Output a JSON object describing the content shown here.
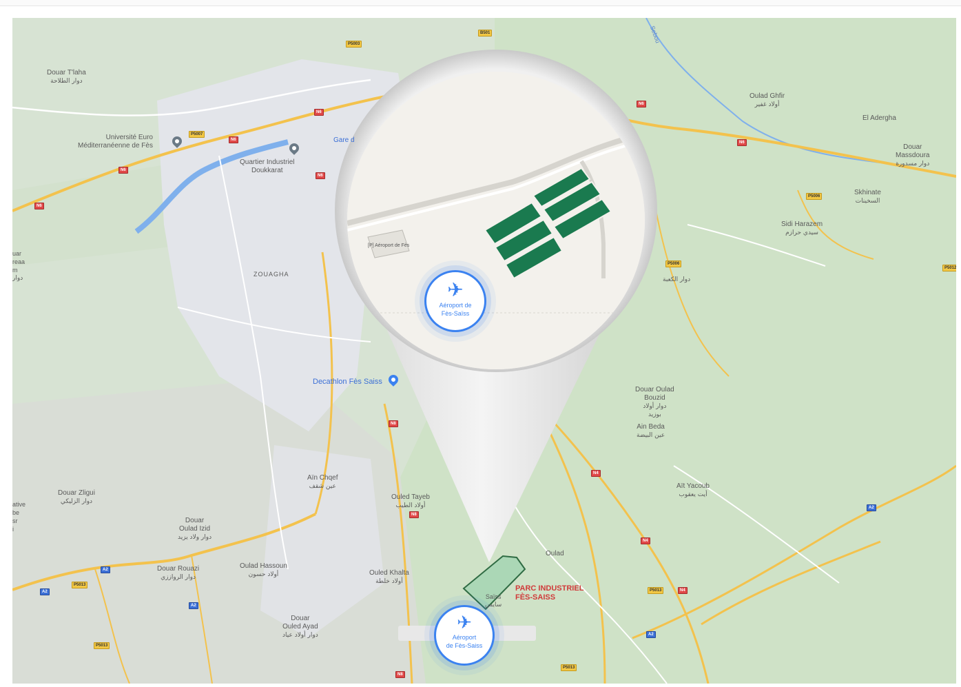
{
  "map": {
    "places": {
      "douar_tlaha": {
        "name": "Douar T'laha",
        "ar": "دوار الطلاحة"
      },
      "universite": {
        "name": "Université Euro\nMéditerranéenne de Fès"
      },
      "quartier_industriel": {
        "name": "Quartier Industriel\nDoukkarat"
      },
      "gare": {
        "name": "Gare d"
      },
      "zouagha": {
        "name": "ZOUAGHA"
      },
      "decathlon": {
        "name": "Decathlon Fès Saiss"
      },
      "douar_zligui": {
        "name": "Douar Zligui",
        "ar": "دوار الزليكي"
      },
      "douar_oulad_izid": {
        "name": "Douar\nOulad Izid",
        "ar": "دوار ولاد يزيد"
      },
      "douar_rouazi": {
        "name": "Douar Rouazi",
        "ar": "دوار الرواززي"
      },
      "oulad_hassoun": {
        "name": "Oulad Hassoun",
        "ar": "أولاد حسون"
      },
      "douar_ouled_ayad": {
        "name": "Douar\nOuled Ayad",
        "ar": "دوار أولاد عياد"
      },
      "ain_chqef": {
        "name": "Aïn Chqef",
        "ar": "عين شقف"
      },
      "oulad_tayeb": {
        "name": "Ouled Tayeb",
        "ar": "أولاد الطيب"
      },
      "ouled_khalta": {
        "name": "Ouled Khalta",
        "ar": "أولاد خلطة"
      },
      "oulad_ghfir": {
        "name": "Oulad Ghfir",
        "ar": "أولاد غفير"
      },
      "el_adergha": {
        "name": "El Adergha"
      },
      "douar_massdoura": {
        "name": "Douar\nMassdoura",
        "ar": "دوار مسدورة"
      },
      "skhinate": {
        "name": "Skhinate",
        "ar": "السخينات"
      },
      "sidi_harazem": {
        "name": "Sidi Harazem",
        "ar": "سيدي حرازم"
      },
      "douar_lakaaba": {
        "ar": "دوار الكعبة"
      },
      "douar_oulad_bouzid": {
        "name": "Douar Oulad\nBouzid",
        "ar": "دوار أولاد\nبوزيد"
      },
      "ain_beda": {
        "name": "Ain Beda",
        "ar": "عين البيضة"
      },
      "ait_yacoub": {
        "name": "Aït Yacoub",
        "ar": "أيت يعقوب"
      },
      "oulad": {
        "name": "Oulad"
      },
      "saiss": {
        "name": "Saïss",
        "ar": "سايس"
      },
      "sebou": {
        "name": "Sebou"
      },
      "left_edge_1": {
        "name": "uar\nreaa\nm",
        "ar": "دوار"
      },
      "left_edge_2": {
        "name": "ative\nbe\nsr\ni"
      }
    },
    "road_shields": {
      "yellow": [
        "P5003",
        "B501",
        "P5007",
        "P5006",
        "P5006",
        "P5012",
        "P5013",
        "P5013",
        "P5013",
        "P5013"
      ],
      "red": [
        "N6",
        "N6",
        "N6",
        "N6",
        "N6",
        "N8",
        "N8",
        "N4",
        "N4",
        "N4",
        "N8",
        "N6",
        "N6"
      ],
      "blue": [
        "A2",
        "A2",
        "A2",
        "A2",
        "A2"
      ]
    },
    "airport_bottom": {
      "name": "Aéroport\nde Fès-Saiss",
      "icon": "airplane-icon"
    },
    "parc_label": "PARC INDUSTRIEL\nFÈS-SAISS",
    "colors": {
      "urban": "#e3e5ea",
      "green": "#cfe3c9",
      "farmland": "#d6e4cf",
      "yellow_road": "#f3c24d",
      "white_road": "#ffffff",
      "river": "#7fb0ec",
      "parcel_fill": "#9fd3b0",
      "parcel_stroke": "#2f6b43",
      "airport_blue": "#3b82f0",
      "parc_red": "#d03a3a"
    }
  },
  "zoom_lens": {
    "airport_label": "Aéroport de\nFès-Saïss",
    "parking_label": "[P] Aéroport\nde Fès",
    "solar_color": "#1a7a4f",
    "icon": "airplane-icon"
  }
}
